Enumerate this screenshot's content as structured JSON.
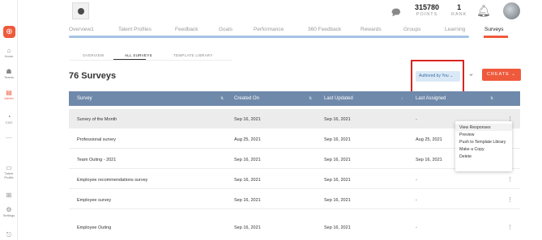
{
  "sidebar": {
    "toggle_icon": "plus-circle-icon",
    "items": [
      {
        "label": "Home",
        "icon": "⌂"
      },
      {
        "label": "Teams",
        "icon": "☗"
      },
      {
        "label": "Admin",
        "icon": "▤"
      },
      {
        "label": "CXO",
        "icon": "◔"
      },
      {
        "label": "",
        "icon": "⋯"
      },
      {
        "label": "Talent Profile",
        "icon": "▭"
      },
      {
        "label": "",
        "icon": "⊞"
      },
      {
        "label": "Settings",
        "icon": "⚙"
      },
      {
        "label": "",
        "icon": "⎋"
      }
    ]
  },
  "header": {
    "points_value": "315780",
    "points_label": "POINTS",
    "rank_value": "1",
    "rank_label": "RANK"
  },
  "tabs": [
    "Overview1",
    "Talent Profiles",
    "Feedback",
    "Goals",
    "Performance",
    "360 Feedback",
    "Rewards",
    "Groups",
    "Learning",
    "Surveys"
  ],
  "subtabs": [
    "OVERVIEW",
    "ALL SURVEYS",
    "TEMPLATE LIBRARY"
  ],
  "page_title": "76 Surveys",
  "filter": {
    "label": "Authored by You",
    "caret": "⌄"
  },
  "create_button": {
    "label": "CREATE",
    "caret": "⌄"
  },
  "table": {
    "columns": [
      "Survey",
      "Created On",
      "Last Updated",
      "Last Assigned"
    ],
    "rows": [
      {
        "survey": "Survey of the Month",
        "created": "Sep 16, 2021",
        "updated": "Sep 16, 2021",
        "assigned": "-"
      },
      {
        "survey": "Professional survey",
        "created": "Aug 25, 2021",
        "updated": "Sep 16, 2021",
        "assigned": "Aug 25, 2021"
      },
      {
        "survey": "Team Outing - 2021",
        "created": "Sep 16, 2021",
        "updated": "Sep 16, 2021",
        "assigned": "Sep 16, 2021"
      },
      {
        "survey": "Employee recommendations survey",
        "created": "Sep 16, 2021",
        "updated": "Sep 16, 2021",
        "assigned": "-"
      },
      {
        "survey": "Employee survey",
        "created": "Sep 16, 2021",
        "updated": "Sep 16, 2021",
        "assigned": "-"
      },
      {
        "survey": "Employee Outing",
        "created": "Sep 16, 2021",
        "updated": "Sep 16, 2021",
        "assigned": "-"
      }
    ]
  },
  "context_menu": [
    "View Responses",
    "Preview",
    "Push to Template Library",
    "Make a Copy",
    "Delete"
  ],
  "colors": {
    "accent": "#ef5a3c",
    "table_header": "#6f89aa",
    "highlight": "#d9251f",
    "filter_bg": "#dbe9f6"
  }
}
